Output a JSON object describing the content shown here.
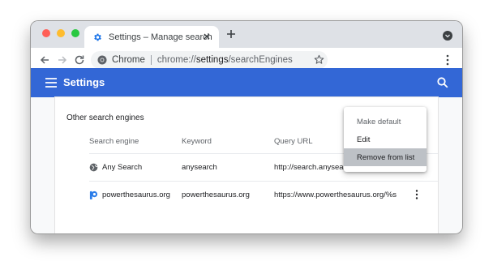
{
  "browser": {
    "tab_title": "Settings – Manage search engines",
    "omnibox_site": "Chrome",
    "url_scheme": "chrome://",
    "url_host": "settings",
    "url_path": "/searchEngines"
  },
  "header": {
    "title": "Settings"
  },
  "section": {
    "title": "Other search engines",
    "columns": [
      "Search engine",
      "Keyword",
      "Query URL"
    ],
    "rows": [
      {
        "name": "Any Search",
        "keyword": "anysearch",
        "query_url": "http://search.anysearch.com/?s=%s",
        "icon": "globe-icon"
      },
      {
        "name": "powerthesaurus.org",
        "keyword": "powerthesaurus.org",
        "query_url": "https://www.powerthesaurus.org/%s",
        "icon": "powerthesaurus-icon"
      }
    ]
  },
  "menu": {
    "items": [
      "Make default",
      "Edit",
      "Remove from list"
    ],
    "highlighted_index": 2
  },
  "colors": {
    "header_blue": "#3367d6",
    "tab_icon_blue": "#1a73e8",
    "menu_hover": "#bdc1c6"
  }
}
